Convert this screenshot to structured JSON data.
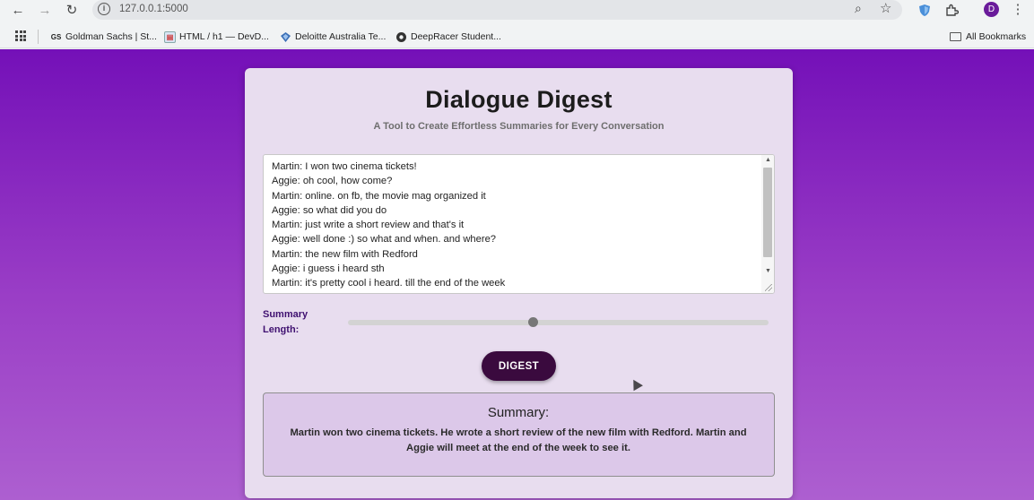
{
  "browser": {
    "url": "127.0.0.1:5000",
    "avatar_initial": "D",
    "bookmarks": [
      {
        "label": "Goldman Sachs | St...",
        "icon": "goldman-sachs-icon",
        "fav": "GS"
      },
      {
        "label": "HTML / h1 — DevD...",
        "icon": "devdocs-icon",
        "fav": ""
      },
      {
        "label": "Deloitte Australia Te...",
        "icon": "deloitte-icon",
        "fav": ""
      },
      {
        "label": "DeepRacer Student...",
        "icon": "deepracer-icon",
        "fav": ""
      }
    ],
    "all_bookmarks_label": "All Bookmarks"
  },
  "app": {
    "title": "Dialogue Digest",
    "subtitle": "A Tool to Create Effortless Summaries for Every Conversation",
    "dialogue_lines": [
      "Martin: I won two cinema tickets!",
      "Aggie: oh cool, how come?",
      "Martin: online. on fb, the movie mag organized it",
      "Aggie: so what did you do",
      "Martin: just write a short review and that's it",
      "Aggie: well done :) so what and when. and where?",
      "Martin: the new film with Redford",
      "Aggie: i guess i heard sth",
      "Martin: it's pretty cool i heard. till the end of the week"
    ],
    "slider_label": "Summary Length:",
    "slider_value_fraction": 0.44,
    "digest_button": "DIGEST",
    "summary_heading": "Summary:",
    "summary_text": "Martin won two cinema tickets. He wrote a short review of the new film with Redford. Martin and Aggie will meet at the end of the week to see it."
  },
  "colors": {
    "background_top": "#7410b8",
    "background_bottom": "#ad5fd0",
    "card": "#e8ddef",
    "button": "#3a0a3e",
    "summary_box": "#dcc8e9",
    "label": "#3f1070"
  }
}
